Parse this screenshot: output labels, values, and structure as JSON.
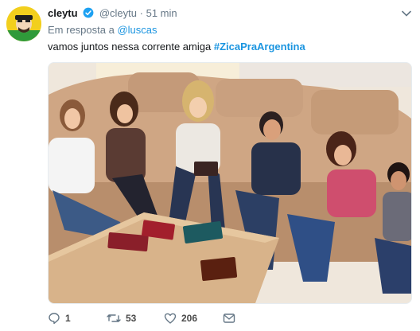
{
  "tweet": {
    "author_name": "cleytu",
    "author_handle": "@cleytu",
    "separator": "·",
    "time": "51 min",
    "reply_prefix": "Em resposta a",
    "reply_to": "@luscas",
    "text": "vamos juntos nessa corrente amiga",
    "hashtag": "#ZicaPraArgentina",
    "verified": true
  },
  "actions": {
    "reply_count": "1",
    "retweet_count": "53",
    "like_count": "206"
  },
  "colors": {
    "link": "#1b95e0",
    "verified": "#1da1f2",
    "muted": "#657786"
  },
  "icons": {
    "verified": "verified-badge-icon",
    "caret": "chevron-down-icon",
    "reply": "reply-icon",
    "retweet": "retweet-icon",
    "like": "heart-icon",
    "dm": "envelope-icon"
  }
}
